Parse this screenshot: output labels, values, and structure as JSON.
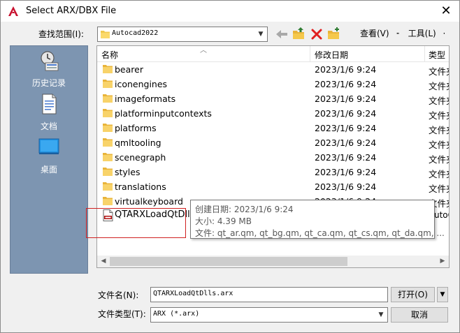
{
  "window": {
    "title": "Select ARX/DBX File",
    "close_symbol": "✕",
    "brand_color": "#c8102e"
  },
  "lookin": {
    "label": "查找范围(I):",
    "value": "Autocad2022"
  },
  "menus": {
    "view_label": "查看(V)",
    "tools_label": "工具(L)",
    "bullet": "·"
  },
  "places": [
    {
      "label": "历史记录",
      "icon": "history-icon"
    },
    {
      "label": "文档",
      "icon": "document-icon"
    },
    {
      "label": "桌面",
      "icon": "desktop-icon"
    }
  ],
  "columns": {
    "name": "名称",
    "date": "修改日期",
    "type": "类型"
  },
  "files": [
    {
      "name": "bearer",
      "date": "2023/1/6 9:24",
      "type": "文件夹"
    },
    {
      "name": "iconengines",
      "date": "2023/1/6 9:24",
      "type": "文件夹"
    },
    {
      "name": "imageformats",
      "date": "2023/1/6 9:24",
      "type": "文件夹"
    },
    {
      "name": "platforminputcontexts",
      "date": "2023/1/6 9:24",
      "type": "文件夹"
    },
    {
      "name": "platforms",
      "date": "2023/1/6 9:24",
      "type": "文件夹"
    },
    {
      "name": "qmltooling",
      "date": "2023/1/6 9:24",
      "type": "文件夹"
    },
    {
      "name": "scenegraph",
      "date": "2023/1/6 9:24",
      "type": "文件夹"
    },
    {
      "name": "styles",
      "date": "2023/1/6 9:24",
      "type": "文件夹"
    },
    {
      "name": "translations",
      "date": "2023/1/6 9:24",
      "type": "文件夹"
    },
    {
      "name": "virtualkeyboard",
      "date": "2023/1/6 9:24",
      "type": "文件夹"
    }
  ],
  "selected_file": {
    "name": "QTARXLoadQtDlls.arx",
    "name_shown": "QTARXLoadQtDlls.",
    "type_shown": "utoC"
  },
  "tooltip": {
    "created": "创建日期: 2023/1/6 9:24",
    "size": "大小: 4.39 MB",
    "files": "文件: qt_ar.qm, qt_bg.qm, qt_ca.qm, qt_cs.qm, qt_da.qm, ..."
  },
  "filename": {
    "label": "文件名(N):",
    "value": "QTARXLoadQtDlls.arx"
  },
  "filetype": {
    "label": "文件类型(T):",
    "value": "ARX (*.arx)"
  },
  "buttons": {
    "open": "打开(O)",
    "cancel": "取消"
  }
}
